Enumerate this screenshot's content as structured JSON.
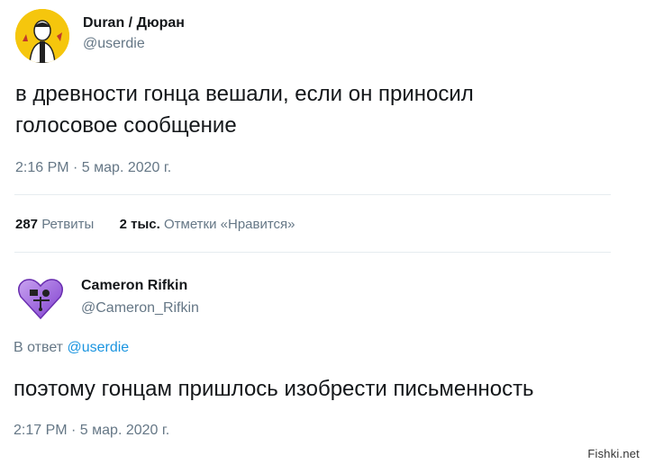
{
  "tweet1": {
    "name": "Duran / Дюран",
    "handle": "@userdie",
    "text_line1": "в древности гонца вешали, если он приносил",
    "text_line2": "голосовое сообщение",
    "timestamp": "2:16 PM · 5 мар. 2020 г.",
    "retweets_count": "287",
    "retweets_label": "Ретвиты",
    "likes_count": "2 тыс.",
    "likes_label": "Отметки «Нравится»"
  },
  "tweet2": {
    "name": "Cameron Rifkin",
    "handle": "@Cameron_Rifkin",
    "reply_prefix": "В ответ",
    "reply_to": "@userdie",
    "text": "поэтому гонцам пришлось изобрести письменность",
    "timestamp": "2:17 PM · 5 мар. 2020 г."
  },
  "watermark": "Fishki.net",
  "colors": {
    "text": "#14171a",
    "secondary": "#657786",
    "link": "#1b95e0",
    "divider": "#e6ecf0"
  }
}
